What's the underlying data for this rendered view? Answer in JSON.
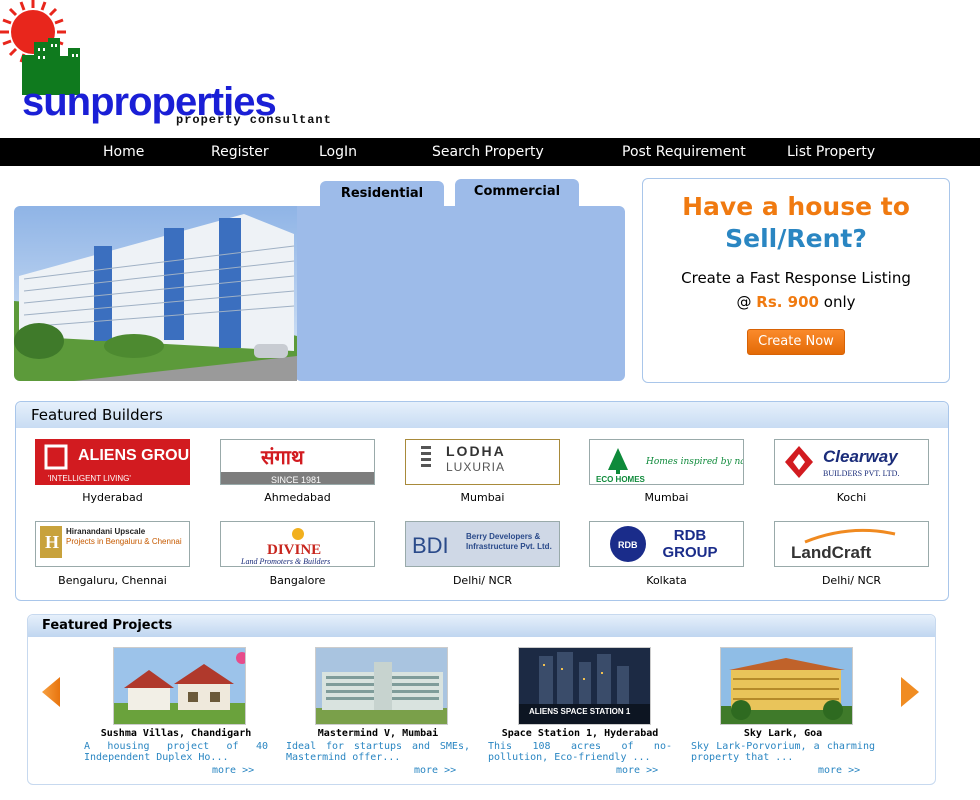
{
  "brand": {
    "name": "sunproperties",
    "tagline": "property consultant"
  },
  "nav": [
    "Home",
    "Register",
    "LogIn",
    "Search Property",
    "Post Requirement",
    "List Property"
  ],
  "tabs": [
    "Residential",
    "Commercial"
  ],
  "sell": {
    "line1": "Have a house to",
    "line2": "Sell/Rent?",
    "line3": "Create a Fast Response Listing",
    "at": "@",
    "price": "Rs. 900",
    "only": "only",
    "button": "Create Now"
  },
  "builders": {
    "title": "Featured Builders",
    "items": [
      {
        "logo": "ALIENS GROUP",
        "sub": "'INTELLIGENT LIVING'",
        "city": "Hyderabad"
      },
      {
        "logo": "संगाथ",
        "sub": "SINCE 1981",
        "city": "Ahmedabad"
      },
      {
        "logo": "LODHA",
        "sub": "LUXURIA",
        "city": "Mumbai"
      },
      {
        "logo": "ECO HOMES",
        "sub": "Homes inspired by nature...",
        "city": "Mumbai"
      },
      {
        "logo": "Clearway",
        "sub": "BUILDERS PVT. LTD.",
        "city": "Kochi"
      },
      {
        "logo": "Hiranandani Upscale",
        "sub": "Projects in Bengaluru & Chennai",
        "city": "Bengaluru, Chennai"
      },
      {
        "logo": "DIVINE",
        "sub": "Land Promoters & Builders",
        "city": "Bangalore"
      },
      {
        "logo": "BDI",
        "sub": "Berry Developers & Infrastructure Pvt. Ltd.",
        "city": "Delhi/ NCR"
      },
      {
        "logo": "RDB GROUP",
        "sub": "RDB",
        "city": "Kolkata"
      },
      {
        "logo": "LandCraft",
        "sub": "",
        "city": "Delhi/ NCR"
      }
    ]
  },
  "projects": {
    "title": "Featured Projects",
    "more": "more >>",
    "items": [
      {
        "name": "Sushma Villas, Chandigarh",
        "desc": "A housing project of 40 Independent Duplex Ho..."
      },
      {
        "name": "Mastermind V, Mumbai",
        "desc": "Ideal for startups and SMEs, Mastermind offer..."
      },
      {
        "name": "Space Station 1, Hyderabad",
        "desc": "This 108 acres of no-pollution, Eco-friendly ..."
      },
      {
        "name": "Sky Lark, Goa",
        "desc": "Sky Lark-Porvorium, a charming property that ..."
      }
    ]
  },
  "colors": {
    "accent": "#f07a10",
    "blue": "#2a86c2",
    "panel": "#9dbbe9",
    "nav": "#000000"
  }
}
